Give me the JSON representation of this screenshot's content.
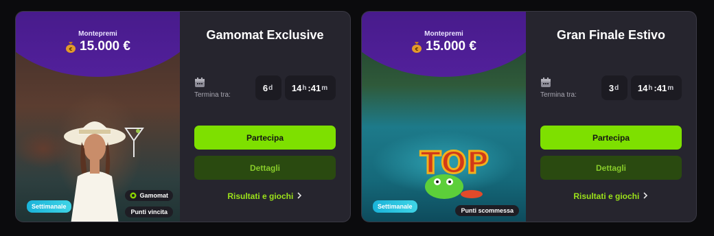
{
  "cards": [
    {
      "prize_label": "Montepremi",
      "prize_amount": "15.000 €",
      "title": "Gamomat Exclusive",
      "ends_label": "Termina tra:",
      "days": "6",
      "days_unit": "d",
      "hours": "14",
      "hours_unit": "h",
      "minutes": "41",
      "minutes_unit": "m",
      "sep": ":",
      "join_label": "Partecipa",
      "details_label": "Dettagli",
      "results_label": "Risultati e giochi",
      "period_badge": "Settimanale",
      "provider": "Gamomat",
      "points_type": "Punti vincita"
    },
    {
      "prize_label": "Montepremi",
      "prize_amount": "15.000 €",
      "title": "Gran Finale Estivo",
      "ends_label": "Termina tra:",
      "days": "3",
      "days_unit": "d",
      "hours": "14",
      "hours_unit": "h",
      "minutes": "41",
      "minutes_unit": "m",
      "sep": ":",
      "join_label": "Partecipa",
      "details_label": "Dettagli",
      "results_label": "Risultati e giochi",
      "period_badge": "Settimanale",
      "points_type": "Punti scommessa"
    }
  ],
  "colors": {
    "accent": "#7ee000",
    "details_bg": "#2a4a10",
    "purple": "#52209b",
    "badge": "#1ab3d9"
  },
  "icons": {
    "calendar": "calendar-icon",
    "bag": "money-bag-icon",
    "chevron": "chevron-right-icon"
  }
}
